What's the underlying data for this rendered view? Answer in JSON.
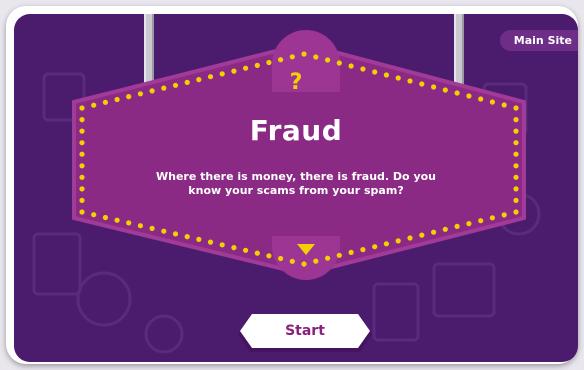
{
  "nav": {
    "main_site_label": "Main Site"
  },
  "quiz": {
    "question_mark": "?",
    "title": "Fraud",
    "description": "Where there is money, there is fraud. Do you know your scams from your spam?",
    "start_label": "Start"
  },
  "colors": {
    "background": "#4b1c6e",
    "sign_fill": "#8b2a84",
    "sign_border": "#a23a98",
    "bulb": "#f4d000",
    "start_text": "#8a1f7c"
  },
  "icons": [
    "question-mark-icon",
    "chevron-down-icon"
  ]
}
